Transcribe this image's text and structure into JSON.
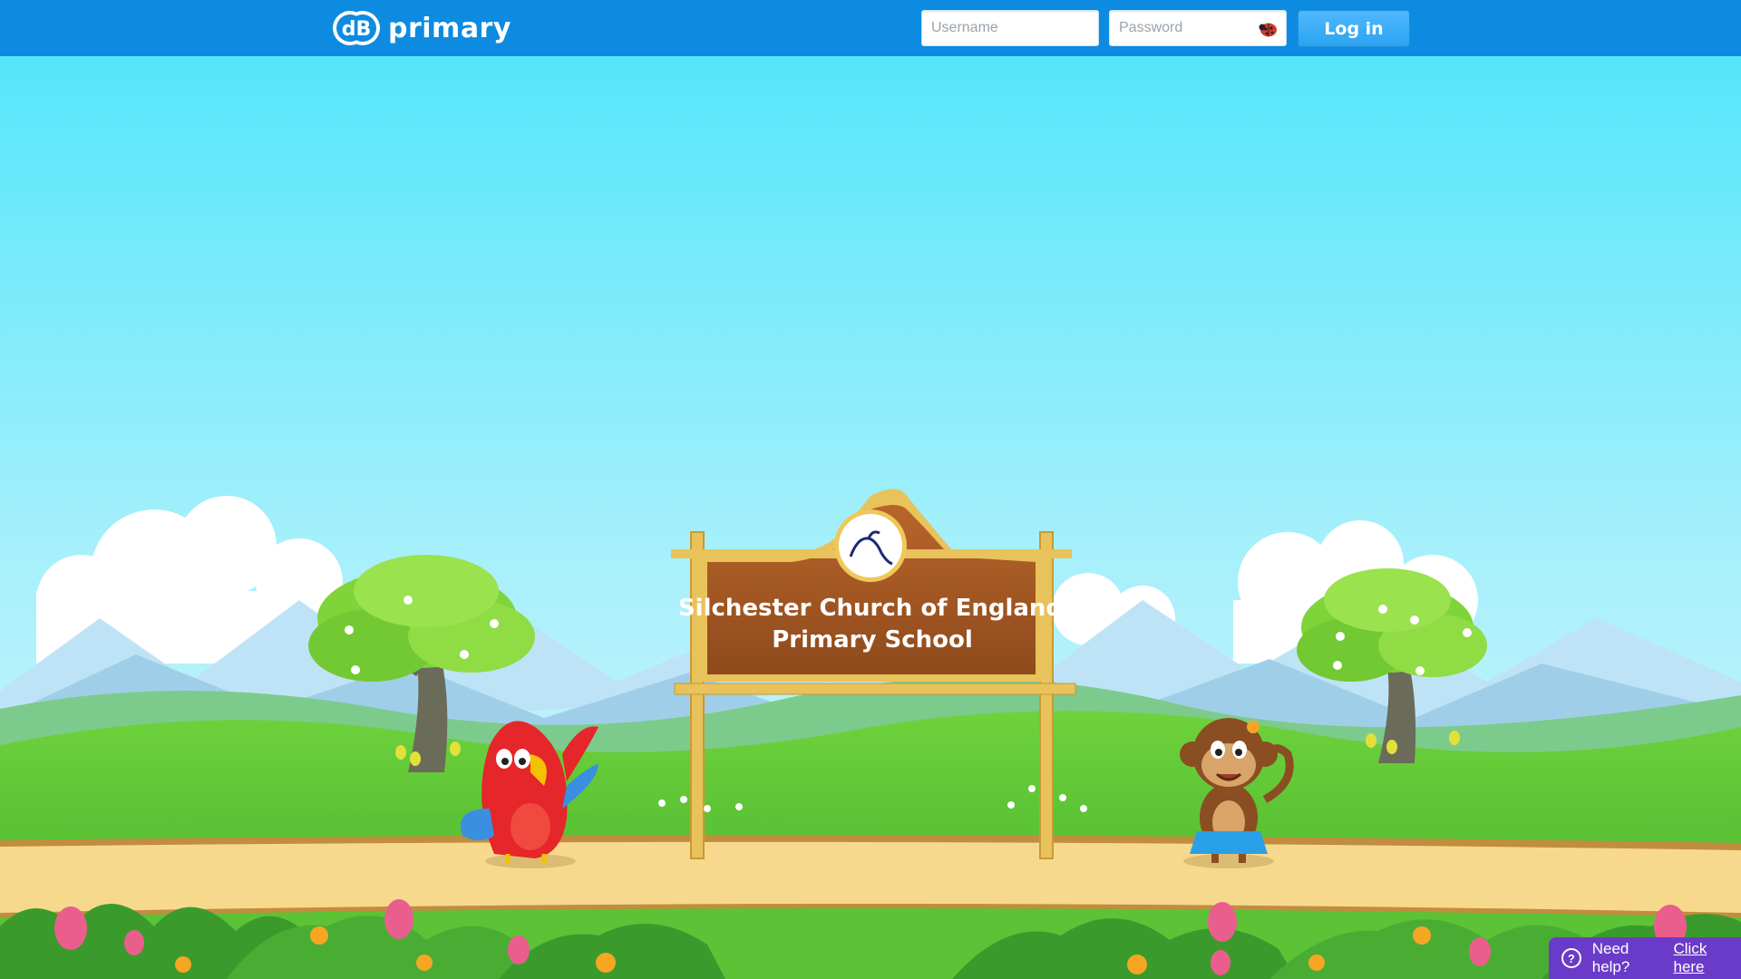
{
  "app": {
    "name": "primary",
    "logo_letters": "dB"
  },
  "login": {
    "username_placeholder": "Username",
    "password_placeholder": "Password",
    "submit_label": "Log in",
    "password_icon": "ladybug-icon"
  },
  "sign": {
    "line1": "Silchester Church of England",
    "line2": "Primary School",
    "crest_icon": "school-crest-horse"
  },
  "help": {
    "prefix": "Need help?",
    "link_label": "Click here",
    "icon": "question-circle-icon"
  },
  "colors": {
    "topbar": "#0d8be0",
    "login_button": "#2ba3f0",
    "help_panel": "#6a3bc8",
    "sky_top": "#55e6fb",
    "sky_bottom": "#c8f4fb",
    "sign_wood": "#a85a24",
    "bamboo": "#e8c25a"
  }
}
